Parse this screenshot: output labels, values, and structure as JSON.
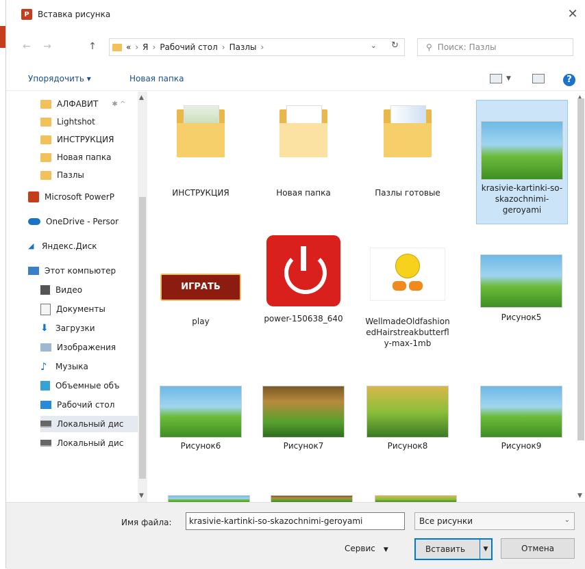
{
  "window": {
    "title": "Вставка рисунка",
    "close": "✕"
  },
  "nav": {
    "back": "←",
    "forward": "→",
    "up": "↑",
    "breadcrumbs": [
      "«",
      "Я",
      "Рабочий стол",
      "Пазлы"
    ],
    "search_placeholder": "Поиск: Пазлы"
  },
  "toolbar": {
    "organize": "Упорядочить ▾",
    "new_folder": "Новая папка",
    "help": "?"
  },
  "sidebar": {
    "items": [
      {
        "label": "АЛФАВИТ",
        "icon": "folder-icon"
      },
      {
        "label": "Lightshot",
        "icon": "folder-icon"
      },
      {
        "label": "ИНСТРУКЦИЯ",
        "icon": "folder-icon"
      },
      {
        "label": "Новая папка",
        "icon": "folder-icon"
      },
      {
        "label": "Пазлы",
        "icon": "folder-icon"
      },
      {
        "label": "Microsoft PowerP",
        "icon": "powerpoint-icon"
      },
      {
        "label": "OneDrive - Persor",
        "icon": "cloud-icon"
      },
      {
        "label": "Яндекс.Диск",
        "icon": "yandex-disk-icon"
      },
      {
        "label": "Этот компьютер",
        "icon": "computer-icon"
      },
      {
        "label": "Видео",
        "icon": "video-icon"
      },
      {
        "label": "Документы",
        "icon": "documents-icon"
      },
      {
        "label": "Загрузки",
        "icon": "downloads-icon"
      },
      {
        "label": "Изображения",
        "icon": "pictures-icon"
      },
      {
        "label": "Музыка",
        "icon": "music-icon"
      },
      {
        "label": "Объемные объ",
        "icon": "3d-objects-icon"
      },
      {
        "label": "Рабочий стол",
        "icon": "desktop-icon"
      },
      {
        "label": "Локальный дис",
        "icon": "drive-icon"
      },
      {
        "label": "Локальный дис",
        "icon": "drive-icon"
      }
    ]
  },
  "files": [
    {
      "name": "ИНСТРУКЦИЯ",
      "type": "folder"
    },
    {
      "name": "Новая папка",
      "type": "folder"
    },
    {
      "name": "Пазлы готовые",
      "type": "folder"
    },
    {
      "name": "krasivie-kartinki-so-skazochnimi-geroyami",
      "type": "image",
      "selected": true
    },
    {
      "name": "play",
      "type": "image",
      "button_text": "ИГРАТЬ"
    },
    {
      "name": "power-150638_640",
      "type": "image"
    },
    {
      "name": "WellmadeOldfashionedHairstreakbutterfly-max-1mb",
      "type": "image"
    },
    {
      "name": "Рисунок5",
      "type": "image"
    },
    {
      "name": "Рисунок6",
      "type": "image"
    },
    {
      "name": "Рисунок7",
      "type": "image"
    },
    {
      "name": "Рисунок8",
      "type": "image"
    },
    {
      "name": "Рисунок9",
      "type": "image"
    }
  ],
  "footer": {
    "filename_label": "Имя файла:",
    "filename_value": "krasivie-kartinki-so-skazochnimi-geroyami",
    "filter_value": "Все рисунки",
    "tools_label": "Сервис",
    "insert_label": "Вставить",
    "cancel_label": "Отмена"
  },
  "colors": {
    "accent": "#0078d7",
    "selection": "#cce4f7",
    "folder": "#f2c15a",
    "powerpoint": "#c43e1c"
  }
}
